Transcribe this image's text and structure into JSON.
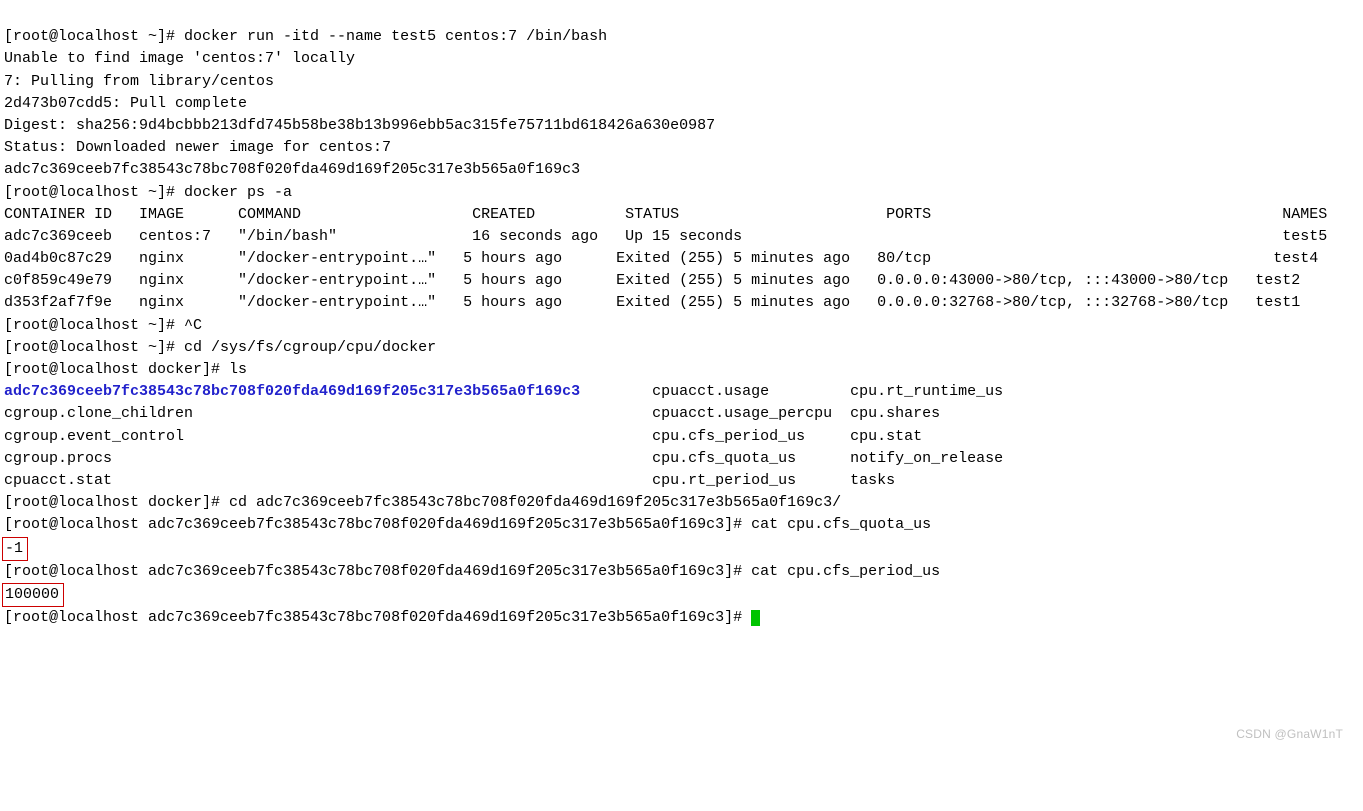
{
  "watermark": "CSDN @GnaW1nT",
  "terminal": {
    "prompt_localhost_home": "[root@localhost ~]# ",
    "prompt_localhost_docker": "[root@localhost docker]# ",
    "long_id": "adc7c369ceeb7fc38543c78bc708f020fda469d169f205c317e3b565a0f169c3",
    "prompt_longdir_prefix": "[root@localhost adc7c369ceeb7fc38543c78bc708f020fda469d169f205c317e3b565a0f169c3]# ",
    "cmd_docker_run": "docker run -itd --name test5 centos:7 /bin/bash",
    "pull_lines": [
      "Unable to find image 'centos:7' locally",
      "7: Pulling from library/centos",
      "2d473b07cdd5: Pull complete",
      "Digest: sha256:9d4bcbbb213dfd745b58be38b13b996ebb5ac315fe75711bd618426a630e0987",
      "Status: Downloaded newer image for centos:7",
      "adc7c369ceeb7fc38543c78bc708f020fda469d169f205c317e3b565a0f169c3"
    ],
    "cmd_docker_ps": "docker ps -a",
    "ps_header": "CONTAINER ID   IMAGE      COMMAND                   CREATED          STATUS                       PORTS                                       NAMES",
    "ps_rows": [
      "adc7c369ceeb   centos:7   \"/bin/bash\"               16 seconds ago   Up 15 seconds                                                            test5",
      "0ad4b0c87c29   nginx      \"/docker-entrypoint.…\"   5 hours ago      Exited (255) 5 minutes ago   80/tcp                                      test4",
      "c0f859c49e79   nginx      \"/docker-entrypoint.…\"   5 hours ago      Exited (255) 5 minutes ago   0.0.0.0:43000->80/tcp, :::43000->80/tcp   test2",
      "d353f2af7f9e   nginx      \"/docker-entrypoint.…\"   5 hours ago      Exited (255) 5 minutes ago   0.0.0.0:32768->80/tcp, :::32768->80/tcp   test1"
    ],
    "cmd_ctrl_c": "^C",
    "cmd_cd_cgroup": "cd /sys/fs/cgroup/cpu/docker",
    "cmd_ls": "ls",
    "ls_cols": [
      [
        "adc7c369ceeb7fc38543c78bc708f020fda469d169f205c317e3b565a0f169c3",
        "cpuacct.usage",
        "cpu.rt_runtime_us"
      ],
      [
        "cgroup.clone_children",
        "cpuacct.usage_percpu",
        "cpu.shares"
      ],
      [
        "cgroup.event_control",
        "cpu.cfs_period_us",
        "cpu.stat"
      ],
      [
        "cgroup.procs",
        "cpu.cfs_quota_us",
        "notify_on_release"
      ],
      [
        "cpuacct.stat",
        "cpu.rt_period_us",
        "tasks"
      ]
    ],
    "cmd_cd_longdir": "cd adc7c369ceeb7fc38543c78bc708f020fda469d169f205c317e3b565a0f169c3/",
    "cmd_cat_quota": "cat cpu.cfs_quota_us",
    "quota_value": "-1",
    "cmd_cat_period": "cat cpu.cfs_period_us",
    "period_value": "100000"
  }
}
